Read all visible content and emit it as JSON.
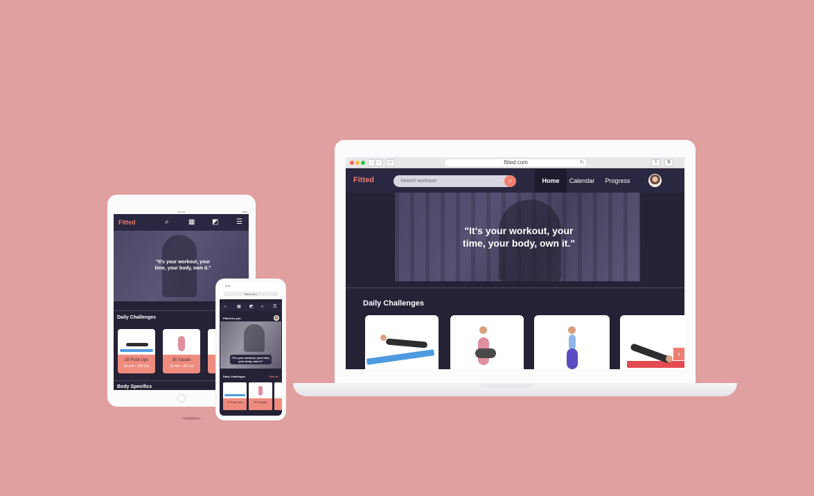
{
  "brand": {
    "name": "Fitted",
    "accent": "#ef7d70",
    "dark": "#252236",
    "nav_bg": "#2a2740",
    "background": "#e0a09f"
  },
  "laptop": {
    "browser": {
      "url": "fitted.com"
    },
    "search": {
      "placeholder": "Search workouts",
      "icon": "search-icon"
    },
    "nav": {
      "home": "Home",
      "calendar": "Calendar",
      "progress": "Progress"
    },
    "hero": {
      "quote_line1": "\"It's your workout, your",
      "quote_line2": "time, your body, own it.\""
    },
    "daily_challenges": {
      "title": "Daily Challenges",
      "next_icon": "chevron-right-icon"
    }
  },
  "tablet": {
    "status": {
      "time": "9:41 AM",
      "battery": "100%"
    },
    "nav_icons": [
      "search-icon",
      "calendar-icon",
      "progress-icon",
      "menu-icon"
    ],
    "hero": {
      "quote_line1": "\"It's your workout, your",
      "quote_line2": "time, your body, own it.\""
    },
    "daily_challenges": {
      "title": "Daily Challenges",
      "cards": [
        {
          "name": "10 Push Ups",
          "meta": "15 min  •  100 Cal"
        },
        {
          "name": "30 Squats",
          "meta": "15 min  •  30 Cal"
        }
      ]
    },
    "body_specifics": {
      "title": "Body Specifics"
    }
  },
  "phone": {
    "status": {
      "time": "9:41"
    },
    "browser": {
      "url": "fitted.com"
    },
    "section_title": "Fitted for you",
    "hero": {
      "quote": "\"It's your workout, your time, your body, own it.\""
    },
    "daily_challenges": {
      "title": "Daily Challenges",
      "see_all": "See all",
      "cards": [
        {
          "name": "10 Push Ups"
        },
        {
          "name": "30 Squats"
        }
      ]
    }
  }
}
